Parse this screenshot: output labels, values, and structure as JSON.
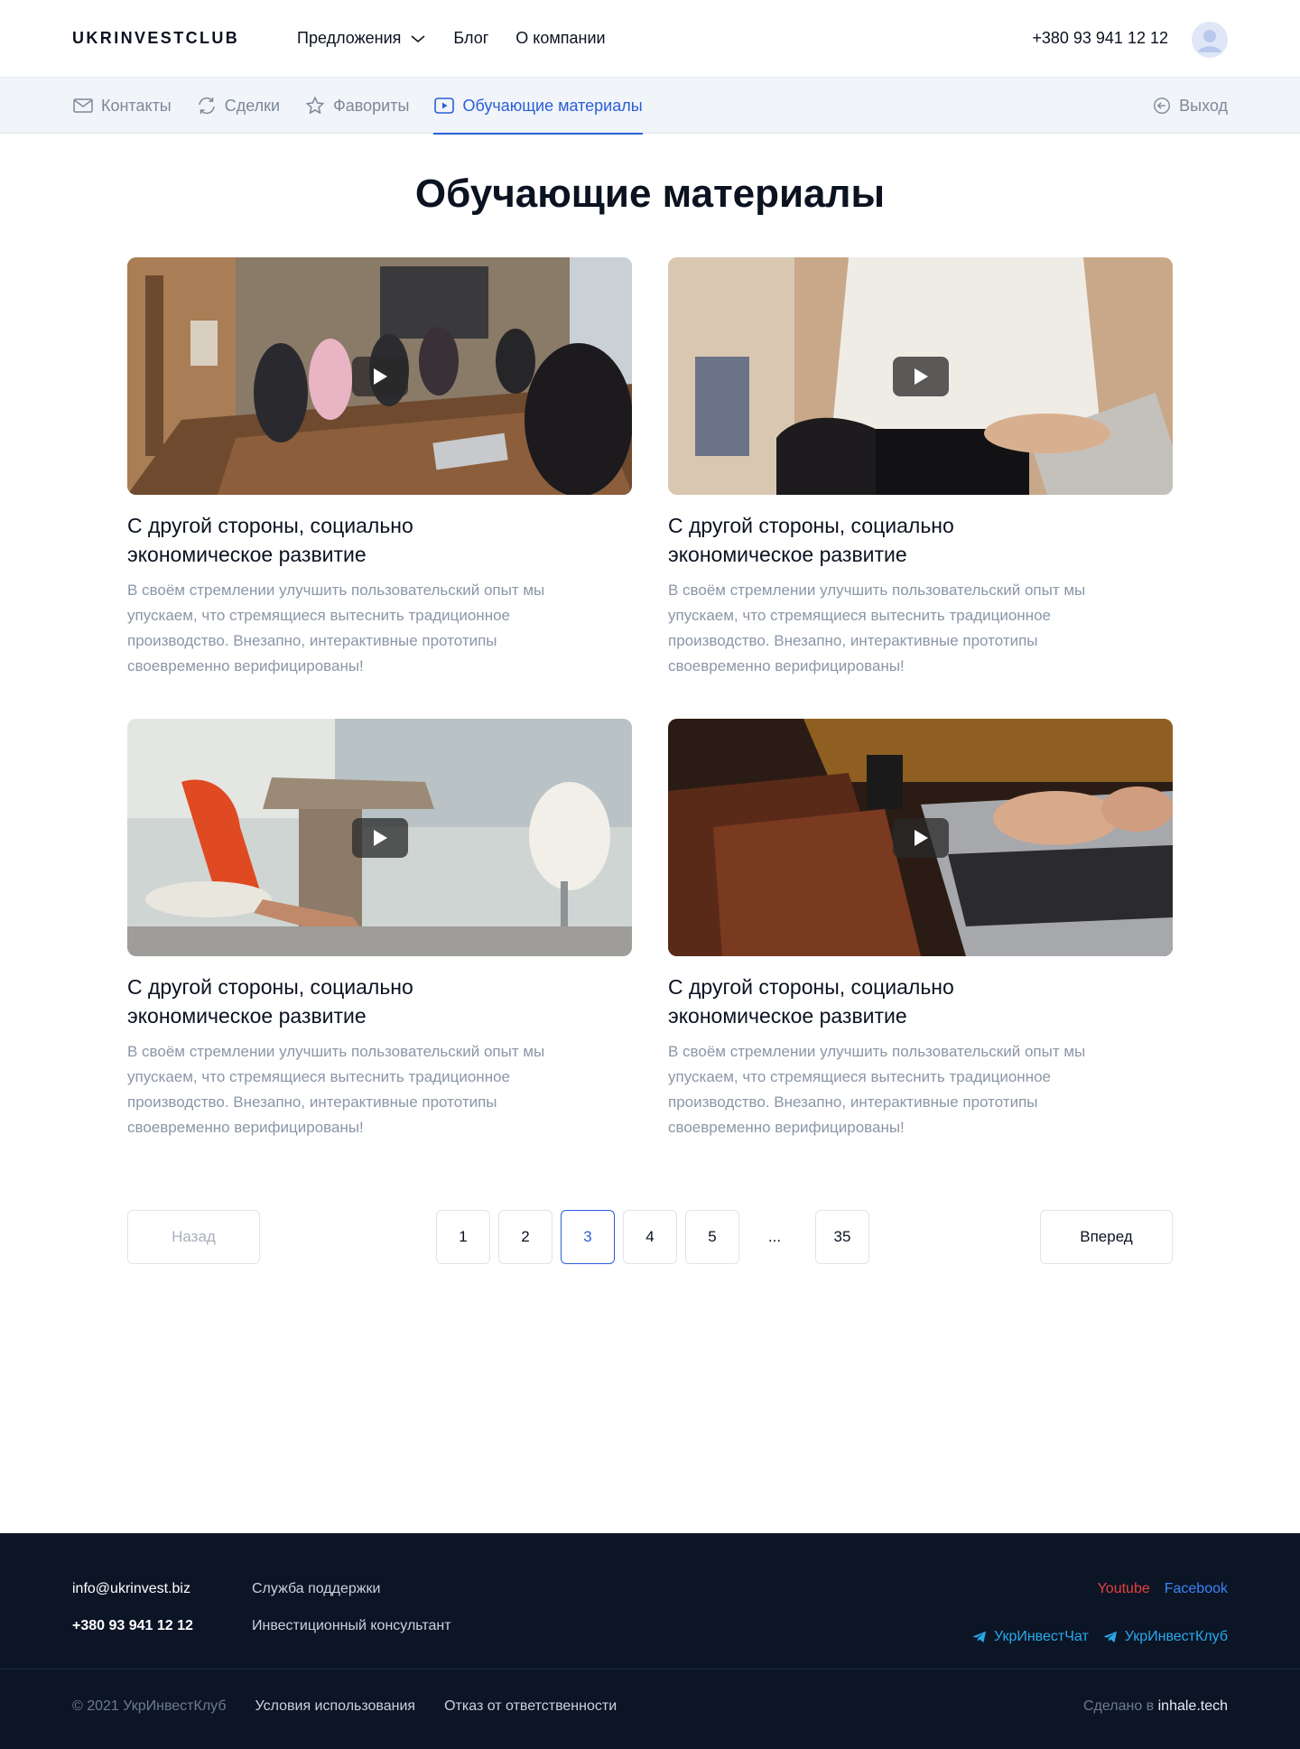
{
  "header": {
    "logo": "UKRINVESTCLUB",
    "nav": [
      {
        "label": "Предложения"
      },
      {
        "label": "Блог"
      },
      {
        "label": "О компании"
      }
    ],
    "phone": "+380 93 941 12 12"
  },
  "subnav": {
    "tabs": [
      {
        "label": "Контакты",
        "icon": "mail-icon"
      },
      {
        "label": "Сделки",
        "icon": "refresh-icon"
      },
      {
        "label": "Фавориты",
        "icon": "star-icon"
      },
      {
        "label": "Обучающие материалы",
        "icon": "play-icon",
        "active": true
      }
    ],
    "logout": "Выход"
  },
  "page": {
    "title": "Обучающие материалы"
  },
  "cards": [
    {
      "title": "С другой стороны, социально экономическое развитие",
      "text": "В своём стремлении улучшить пользовательский опыт мы упускаем, что стремящиеся вытеснить традиционное производство. Внезапно, интерактивные прототипы своевременно верифицированы!"
    },
    {
      "title": "С другой стороны, социально экономическое развитие",
      "text": "В своём стремлении улучшить пользовательский опыт мы упускаем, что стремящиеся вытеснить традиционное производство. Внезапно, интерактивные прототипы своевременно верифицированы!"
    },
    {
      "title": "С другой стороны, социально экономическое развитие",
      "text": "В своём стремлении улучшить пользовательский опыт мы упускаем, что стремящиеся вытеснить традиционное производство. Внезапно, интерактивные прототипы своевременно верифицированы!"
    },
    {
      "title": "С другой стороны, социально экономическое развитие",
      "text": "В своём стремлении улучшить пользовательский опыт мы упускаем, что стремящиеся вытеснить традиционное производство. Внезапно, интерактивные прототипы своевременно верифицированы!"
    }
  ],
  "pagination": {
    "prev": "Назад",
    "next": "Вперед",
    "pages": [
      "1",
      "2",
      "3",
      "4",
      "5"
    ],
    "ellipsis": "...",
    "last": "35",
    "current": "3"
  },
  "footer": {
    "email": "info@ukrinvest.biz",
    "phone": "+380 93 941 12 12",
    "links": [
      "Служба поддержки",
      "Инвестиционный консультант"
    ],
    "social": {
      "youtube": "Youtube",
      "facebook": "Facebook"
    },
    "telegram": [
      "УкрИнвестЧат",
      "УкрИнвестКлуб"
    ],
    "copyright": "© 2021 УкрИнвестКлуб",
    "terms": "Условия использования",
    "disclaimer": "Отказ от ответственности",
    "made_by_prefix": "Сделано в",
    "made_by_brand": "inhale.tech"
  },
  "colors": {
    "accent": "#2b5fd9",
    "footer_bg": "#0c1526",
    "youtube": "#e5423b",
    "facebook": "#3b82f6",
    "telegram": "#29a9eb"
  }
}
